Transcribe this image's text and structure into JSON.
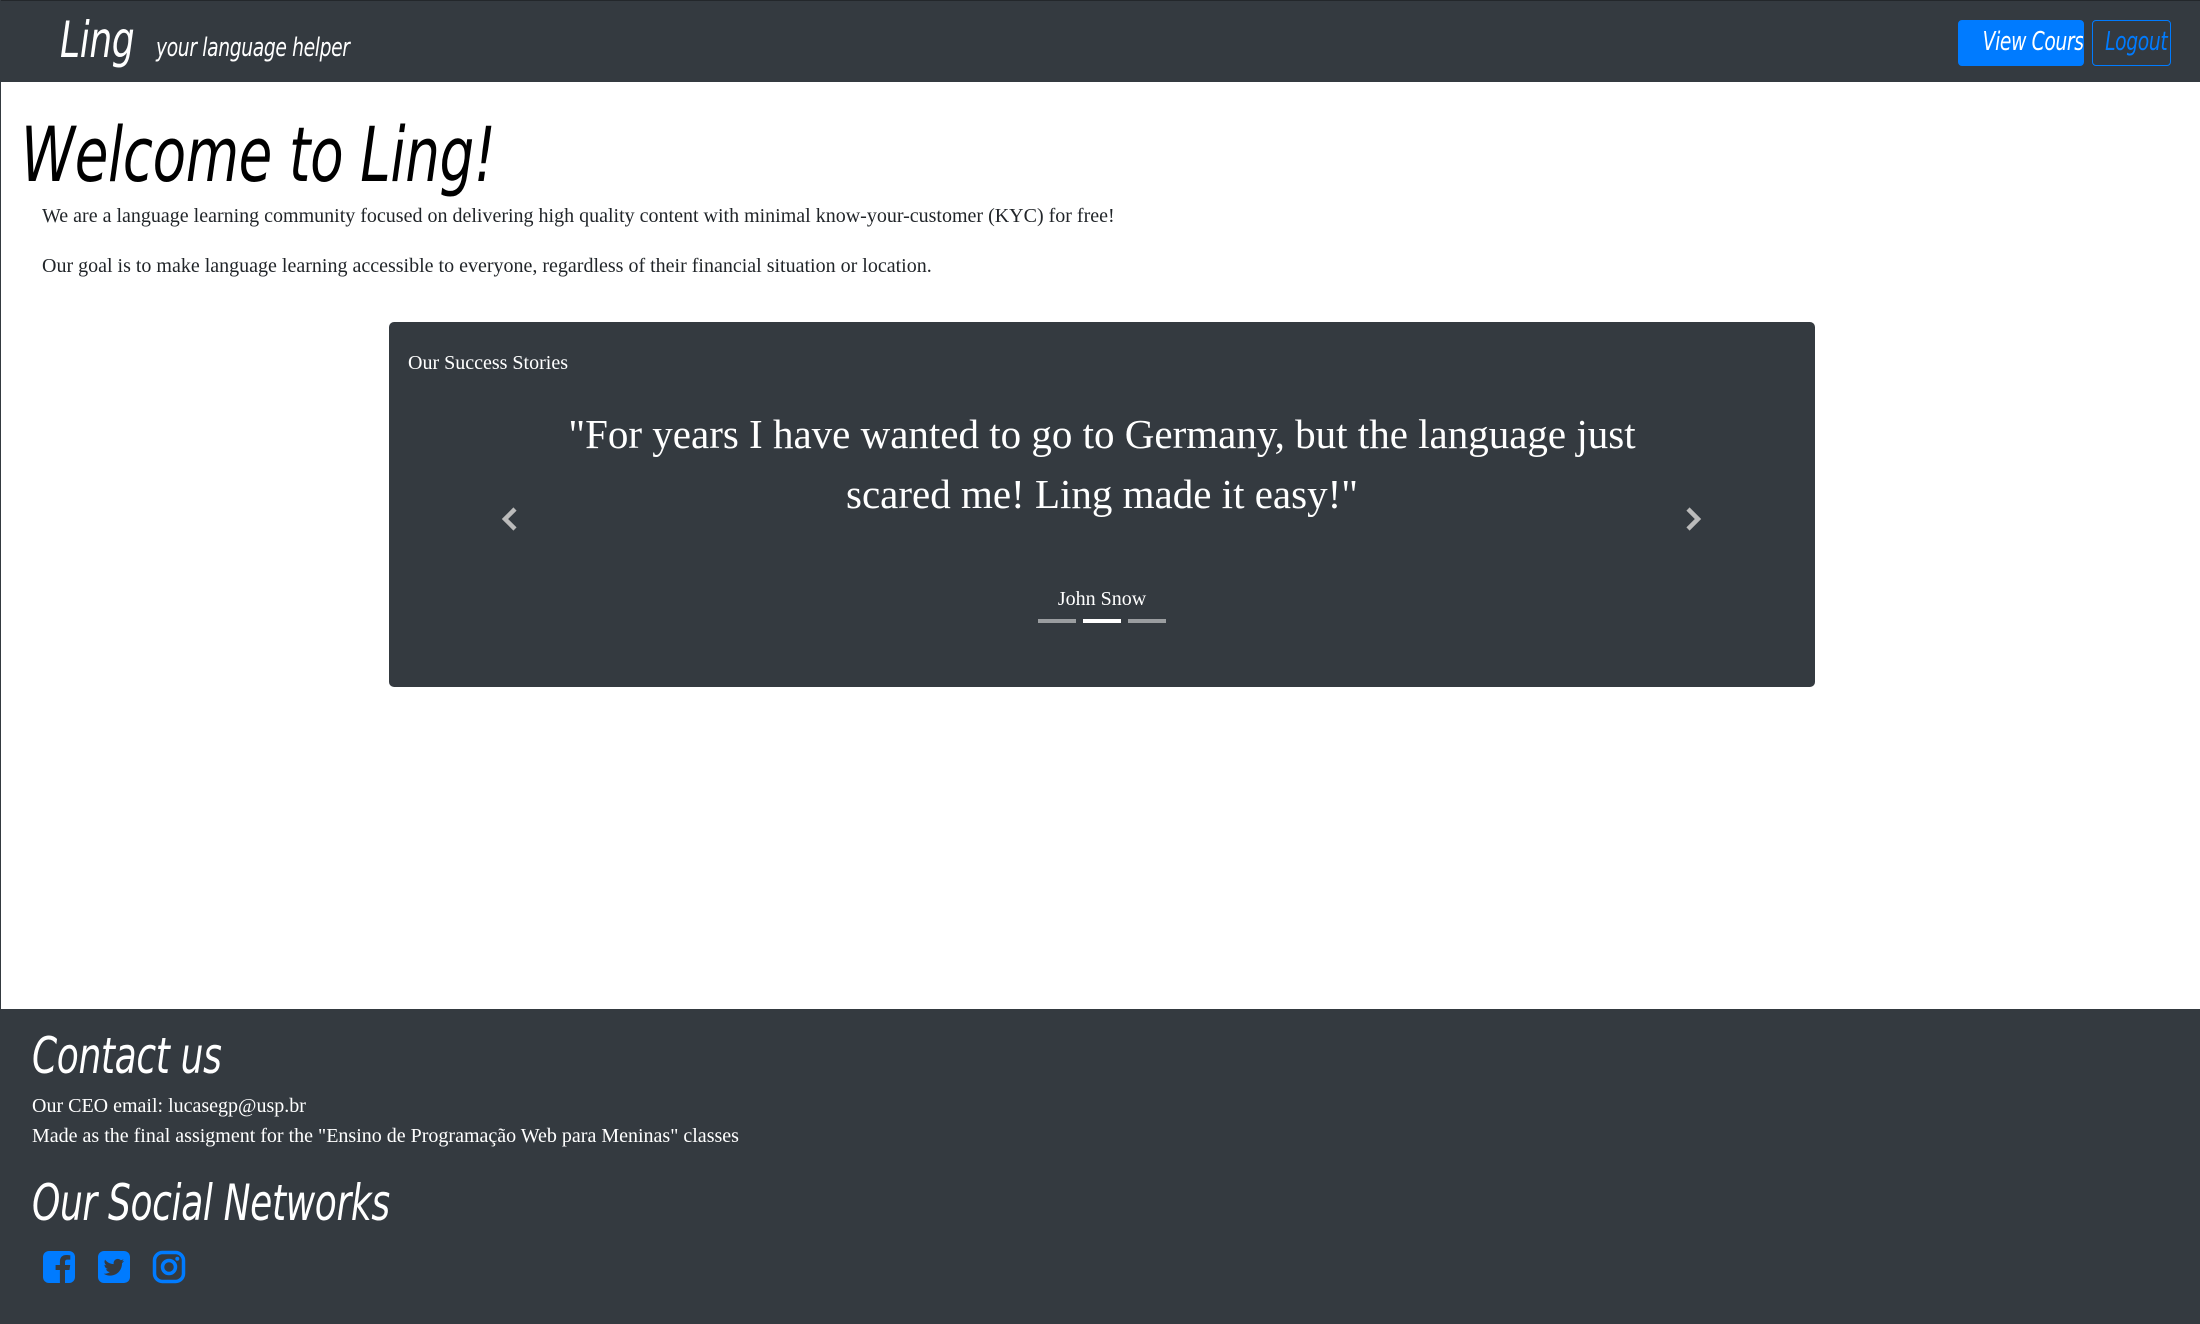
{
  "navbar": {
    "brand": "Ling",
    "tagline": "your language helper",
    "view_courses_label": "View Courses",
    "logout_label": "Logout"
  },
  "main": {
    "title": "Welcome to Ling!",
    "paragraphs": [
      "We are a language learning community focused on delivering high quality content with minimal know-your-customer (KYC) for free!",
      "Our goal is to make language learning accessible to everyone, regardless of their financial situation or location."
    ]
  },
  "stories": {
    "title": "Our Success Stories",
    "quote": "\"For years I have wanted to go to Germany, but the language just scared me! Ling made it easy!\"",
    "author": "John Snow",
    "prev_icon": "chevron-left-icon",
    "next_icon": "chevron-right-icon",
    "indicator_count": 3,
    "active_indicator": 2
  },
  "footer": {
    "contact_title": "Contact us",
    "ceo_email": "Our CEO email: lucasegp@usp.br",
    "made_for": "Made as the final assigment for the \"Ensino de Programação Web para Meninas\" classes",
    "social_title": "Our Social Networks",
    "social_icons": [
      "facebook-icon",
      "twitter-icon",
      "instagram-icon"
    ]
  },
  "colors": {
    "dark": "#343a40",
    "primary": "#007bff",
    "white": "#ffffff"
  }
}
